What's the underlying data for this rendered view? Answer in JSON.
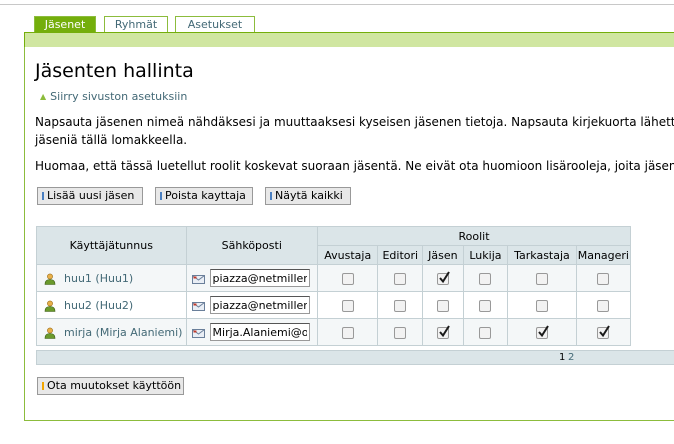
{
  "tabs": [
    {
      "label": "Jäsenet",
      "active": true
    },
    {
      "label": "Ryhmät",
      "active": false
    },
    {
      "label": "Asetukset",
      "active": false
    }
  ],
  "page": {
    "title": "Jäsenten hallinta",
    "back_link": "Siirry sivuston asetuksiin",
    "para1_line1": "Napsauta jäsenen nimeä nähdäksesi ja muuttaaksesi kyseisen jäsenen tietoja. Napsauta kirjekuorta lähettääks",
    "para1_line2": "jäseniä tällä lomakkeella.",
    "para2": "Huomaa, että tässä luetellut roolit koskevat suoraan jäsentä. Ne eivät ota huomioon lisärooleja, joita jäsenillä"
  },
  "buttons": {
    "add_user": "Lisää uusi jäsen",
    "delete_user": "Poista kayttaja",
    "show_all": "Näytä kaikki",
    "apply_changes": "Ota muutokset käyttöön"
  },
  "table": {
    "col_username": "Käyttäjätunnus",
    "col_email": "Sähköposti",
    "col_roles": "Roolit",
    "roles": [
      "Avustaja",
      "Editori",
      "Jäsen",
      "Lukija",
      "Tarkastaja",
      "Manageri"
    ],
    "rows": [
      {
        "user": "huu1 (Huu1)",
        "email": "piazza@netmiller",
        "roles": [
          false,
          false,
          true,
          false,
          false,
          false
        ]
      },
      {
        "user": "huu2 (Huu2)",
        "email": "piazza@netmiller",
        "roles": [
          false,
          false,
          false,
          false,
          false,
          false
        ]
      },
      {
        "user": "mirja (Mirja Alaniemi)",
        "email": "Mirja.Alaniemi@o",
        "roles": [
          false,
          false,
          true,
          false,
          true,
          true
        ]
      }
    ]
  },
  "pager": {
    "pages": [
      "1",
      "2"
    ],
    "current": "1"
  },
  "colors": {
    "accent_green": "#74ae0b",
    "link": "#436976",
    "header_bg": "#dbe5e8"
  },
  "icons": {
    "user": "user-icon",
    "mail": "envelope-icon",
    "back": "arrow-up-icon"
  }
}
